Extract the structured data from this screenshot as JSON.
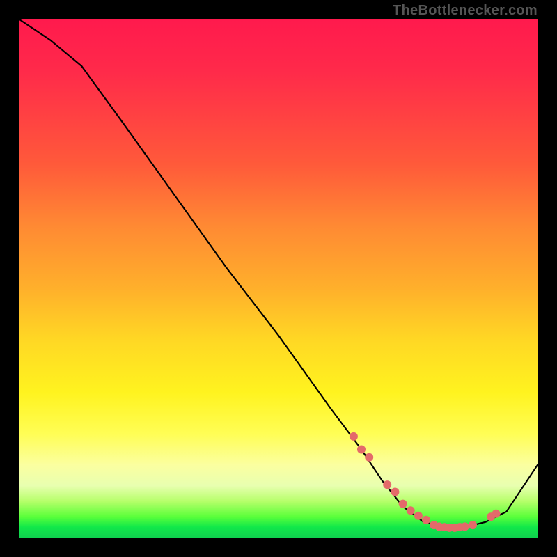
{
  "watermark": "TheBottlenecker.com",
  "chart_data": {
    "type": "line",
    "title": "",
    "xlabel": "",
    "ylabel": "",
    "xlim": [
      0,
      100
    ],
    "ylim": [
      0,
      100
    ],
    "series": [
      {
        "name": "bottleneck-curve",
        "x": [
          0,
          6,
          12,
          20,
          30,
          40,
          50,
          60,
          66,
          70,
          74,
          78,
          82,
          86,
          90,
          94,
          100
        ],
        "values": [
          100,
          96,
          91,
          80,
          66,
          52,
          39,
          25,
          17,
          11,
          6,
          3,
          2,
          2,
          3,
          5,
          14
        ],
        "color": "#000000"
      }
    ],
    "markers": {
      "name": "highlight-points",
      "x": [
        64.5,
        66,
        67.5,
        71,
        72.5,
        74,
        75.5,
        77,
        78.5,
        80,
        81,
        82,
        83,
        84,
        85,
        86,
        87.5,
        91,
        92
      ],
      "values": [
        19.5,
        17,
        15.5,
        10.2,
        8.8,
        6.5,
        5.2,
        4.2,
        3.4,
        2.4,
        2.1,
        2.0,
        1.9,
        1.9,
        2.0,
        2.1,
        2.4,
        4.0,
        4.6
      ],
      "color": "#e46a6a",
      "radius_px": 6
    },
    "gradient_stops": [
      {
        "pos": 0.0,
        "color": "#ff1a4d"
      },
      {
        "pos": 0.28,
        "color": "#ff5a3a"
      },
      {
        "pos": 0.62,
        "color": "#ffd824"
      },
      {
        "pos": 0.86,
        "color": "#fbffa0"
      },
      {
        "pos": 0.96,
        "color": "#5aff3a"
      },
      {
        "pos": 1.0,
        "color": "#0fd24e"
      }
    ]
  }
}
